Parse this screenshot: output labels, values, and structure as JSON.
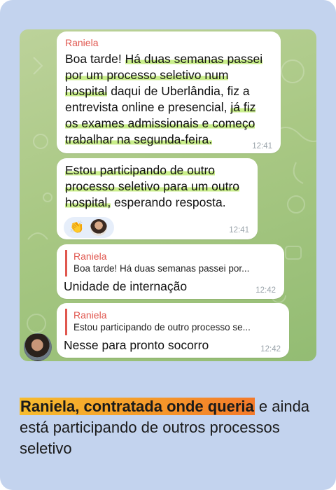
{
  "chat": {
    "messages": [
      {
        "sender": "Raniela",
        "lines": [
          [
            {
              "t": "Boa tarde! ",
              "h": false
            },
            {
              "t": "Há duas semanas passei",
              "h": true
            }
          ],
          [
            {
              "t": "por um processo seletivo num",
              "h": true
            }
          ],
          [
            {
              "t": "hospital",
              "h": true
            },
            {
              "t": " daqui de Uberlândia, fiz a",
              "h": false
            }
          ],
          [
            {
              "t": "entrevista online e presencial, ",
              "h": false
            },
            {
              "t": "já fiz",
              "h": true
            }
          ],
          [
            {
              "t": "os exames admissionais e começo",
              "h": true
            }
          ],
          [
            {
              "t": "trabalhar na segunda-feira.",
              "h": true
            }
          ]
        ],
        "time": "12:41"
      },
      {
        "lines": [
          [
            {
              "t": "Estou participando de outro",
              "h": true
            }
          ],
          [
            {
              "t": "processo seletivo para um outro",
              "h": true
            }
          ],
          [
            {
              "t": "hospital,",
              "h": true
            },
            {
              "t": " esperando resposta.",
              "h": false
            }
          ]
        ],
        "reaction_emoji": "👏",
        "time": "12:41"
      },
      {
        "reply_name": "Raniela",
        "reply_text": "Boa tarde! Há duas semanas passei por...",
        "text": "Unidade de internação",
        "time": "12:42"
      },
      {
        "reply_name": "Raniela",
        "reply_text": "Estou participando de outro processo se...",
        "text": "Nesse para pronto socorro",
        "time": "12:42"
      }
    ]
  },
  "caption": {
    "highlight": "Raniela, contratada onde queria",
    "rest": " e ainda está participando de outros processos seletivo"
  },
  "colors": {
    "card_bg": "#c3d3ee",
    "sender": "#e0574f",
    "highlight": "#c9ee8a",
    "caption_highlight": "#f59a2a"
  }
}
